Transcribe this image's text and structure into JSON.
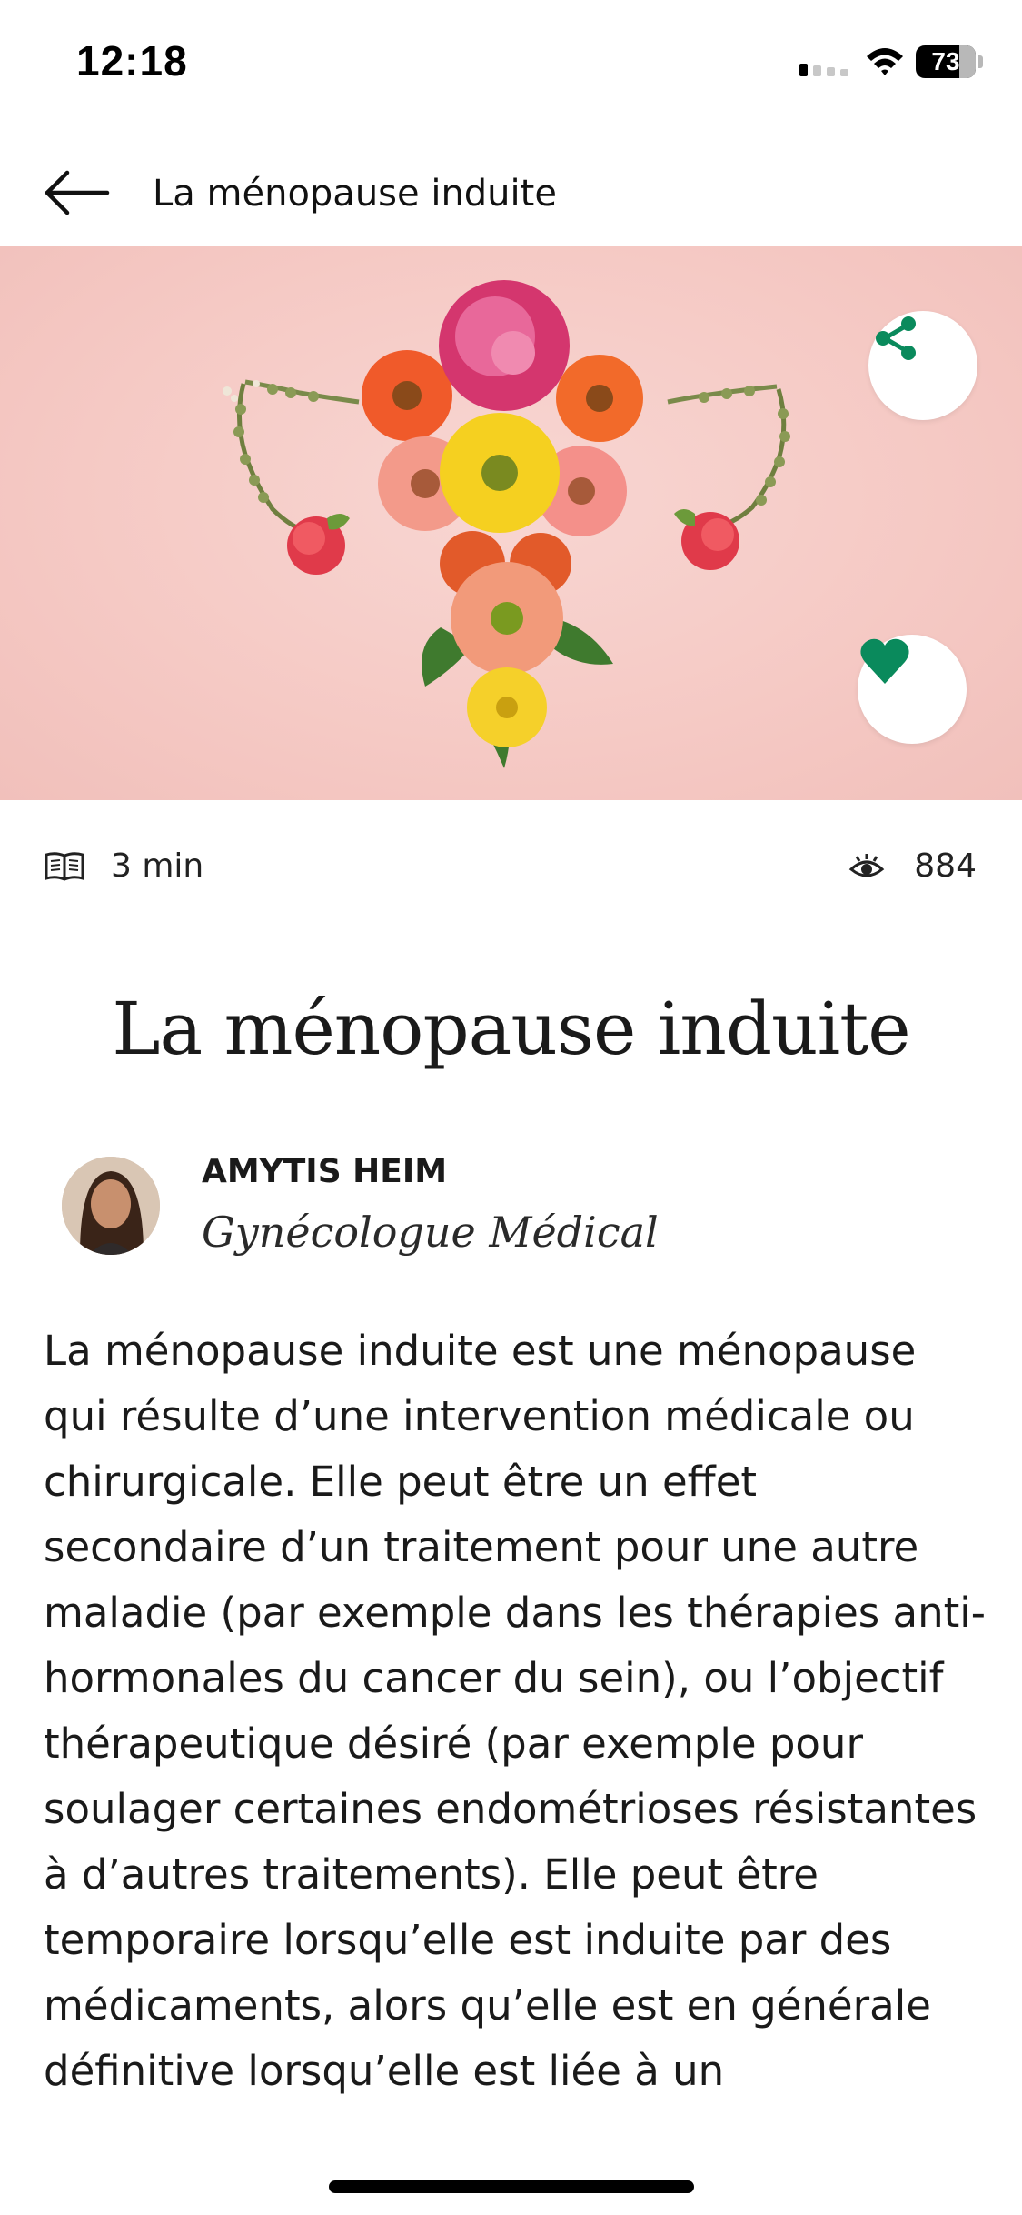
{
  "status_bar": {
    "time": "12:18",
    "battery": "73",
    "battery_level": 0.73
  },
  "header": {
    "title": "La ménopause induite",
    "back_icon": "arrow-left-icon"
  },
  "hero": {
    "share_icon": "share-icon",
    "favorite_icon": "heart-icon",
    "accent_color": "#0a8a5c"
  },
  "meta": {
    "read_time": "3 min",
    "read_time_icon": "book-icon",
    "views": "884",
    "views_icon": "eye-icon"
  },
  "article": {
    "title": "La ménopause induite",
    "author_name": "AMYTIS HEIM",
    "author_role": "Gynécologue Médical",
    "body": "La ménopause induite est une ménopause qui résulte d’une intervention médicale ou chirurgicale. Elle peut être un effet secondaire d’un traitement pour une autre maladie (par exemple dans les thérapies anti-hormonales du cancer du sein), ou l’objectif thérapeutique désiré (par exemple pour soulager certaines endométrioses résistantes à d’autres traitements). Elle peut être temporaire lorsqu’elle est induite par des médicaments, alors qu’elle est en générale définitive lorsqu’elle est liée à un"
  }
}
